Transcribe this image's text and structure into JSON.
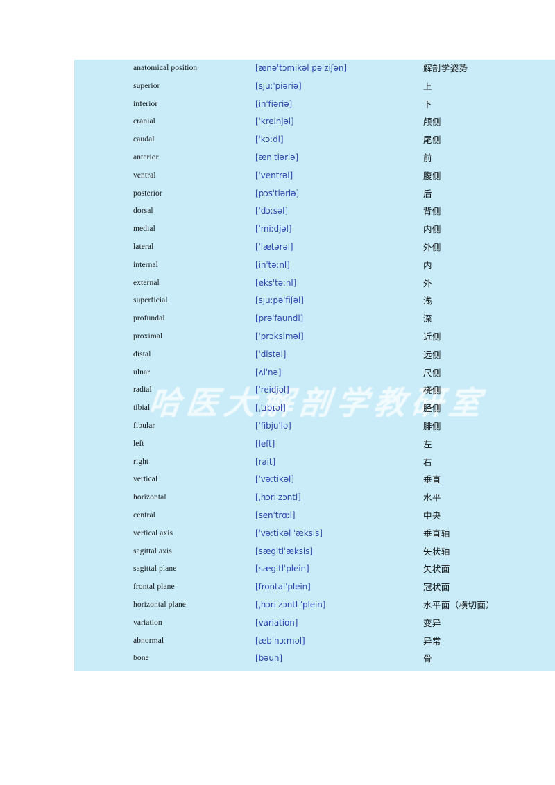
{
  "page": {
    "background_color": "#ffffff",
    "panel_color": "#c9ecf8"
  },
  "watermark": {
    "text": "哈医大解剖学教研室",
    "color": "#ffffff"
  },
  "colors": {
    "term_text": "#1a1a1a",
    "phonetic_text": "#2f46ad",
    "chinese_text": "#141414",
    "panel_background": "#c9ecf8"
  },
  "table": {
    "columns": [
      "term",
      "phonetic",
      "chinese"
    ],
    "rows": [
      {
        "term": "anatomical position",
        "phonetic": "[ænəˈtɔmikəl pəˈziʃən]",
        "chinese": "解剖学姿势"
      },
      {
        "term": "superior",
        "phonetic": "[sjuːˈpiəriə]",
        "chinese": "上"
      },
      {
        "term": "inferior",
        "phonetic": "[inˈfiəriə]",
        "chinese": "下"
      },
      {
        "term": "cranial",
        "phonetic": "[ˈkreinjəl]",
        "chinese": "颅侧"
      },
      {
        "term": "caudal",
        "phonetic": "[ˈkɔːdl]",
        "chinese": "尾侧"
      },
      {
        "term": "anterior",
        "phonetic": "[ænˈtiəriə]",
        "chinese": "前"
      },
      {
        "term": "ventral",
        "phonetic": "[ˈventrəl]",
        "chinese": "腹侧"
      },
      {
        "term": "posterior",
        "phonetic": "[pɔsˈtiəriə]",
        "chinese": "后"
      },
      {
        "term": "dorsal",
        "phonetic": "[ˈdɔːsəl]",
        "chinese": "背侧"
      },
      {
        "term": "medial",
        "phonetic": "[ˈmiːdjəl]",
        "chinese": "内侧"
      },
      {
        "term": "lateral",
        "phonetic": "[ˈlætərəl]",
        "chinese": "外侧"
      },
      {
        "term": "internal",
        "phonetic": "[inˈtəːnl]",
        "chinese": "内"
      },
      {
        "term": "external",
        "phonetic": "[eksˈtəːnl]",
        "chinese": "外"
      },
      {
        "term": "superficial",
        "phonetic": "[sjuːpəˈfiʃəl]",
        "chinese": "浅"
      },
      {
        "term": "profundal",
        "phonetic": "[prəˈfaundl]",
        "chinese": "深"
      },
      {
        "term": "proximal",
        "phonetic": "[ˈprɔksiməl]",
        "chinese": "近侧"
      },
      {
        "term": "distal",
        "phonetic": "[ˈdistəl]",
        "chinese": "远侧"
      },
      {
        "term": "ulnar",
        "phonetic": "[ʌlˈnə]",
        "chinese": "尺侧"
      },
      {
        "term": "radial",
        "phonetic": "[ˈreidjəl]",
        "chinese": "桡侧"
      },
      {
        "term": "tibial",
        "phonetic": "[ˌtɪbɪəl]",
        "chinese": "胫侧"
      },
      {
        "term": "fibular",
        "phonetic": "[ˈfibjuˈlə]",
        "chinese": "腓侧"
      },
      {
        "term": "left",
        "phonetic": "[left]",
        "chinese": "左"
      },
      {
        "term": "right",
        "phonetic": "[rait]",
        "chinese": "右"
      },
      {
        "term": "vertical",
        "phonetic": "[ˈvəːtikəl]",
        "chinese": "垂直"
      },
      {
        "term": "horizontal",
        "phonetic": "[ˌhɔriˈzɔntl]",
        "chinese": "水平"
      },
      {
        "term": "central",
        "phonetic": "[senˈtrɑːl]",
        "chinese": "中央"
      },
      {
        "term": "vertical axis",
        "phonetic": "[ˈvəːtikəl ˈæksis]",
        "chinese": "垂直轴"
      },
      {
        "term": "sagittal axis",
        "phonetic": "[sægitlˈæksis]",
        "chinese": "矢状轴"
      },
      {
        "term": "sagittal plane",
        "phonetic": "[sægitlˈplein]",
        "chinese": "矢状面"
      },
      {
        "term": "frontal plane",
        "phonetic": "[frontalˈplein]",
        "chinese": "冠状面"
      },
      {
        "term": "horizontal plane",
        "phonetic": "[ˌhɔriˈzɔntl ˈplein]",
        "chinese": "水平面（横切面）"
      },
      {
        "term": "variation",
        "phonetic": "[variation]",
        "chinese": "变异"
      },
      {
        "term": "abnormal",
        "phonetic": "[æbˈnɔːməl]",
        "chinese": "异常"
      },
      {
        "term": "bone",
        "phonetic": "[bəun]",
        "chinese": "骨"
      }
    ]
  }
}
